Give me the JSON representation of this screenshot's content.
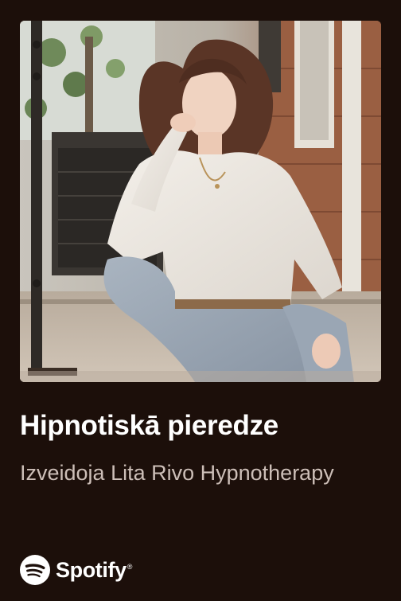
{
  "playlist": {
    "title": "Hipnotiskā pieredze",
    "subtitle": "Izveidoja Lita Rivo Hypnotherapy",
    "cover_alt": "Playlist cover photo"
  },
  "brand": {
    "name": "Spotify",
    "registered_mark": "®",
    "icon": "spotify-logo-icon"
  },
  "colors": {
    "background": "#1c0f0a",
    "title": "#ffffff",
    "subtitle": "#cdbfb8"
  }
}
